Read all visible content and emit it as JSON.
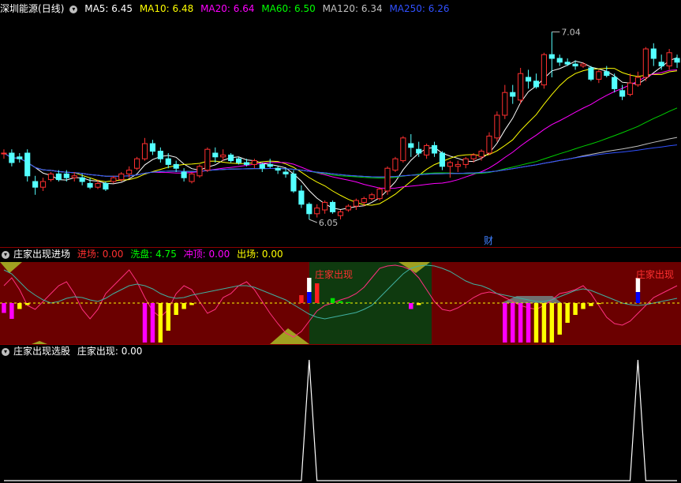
{
  "main": {
    "title": "深圳能源",
    "period": "(日线)",
    "ma": [
      {
        "label": "MA5: 6.45",
        "color": "#ffffff"
      },
      {
        "label": "MA10: 6.48",
        "color": "#ffff00"
      },
      {
        "label": "MA20: 6.64",
        "color": "#ff00ff"
      },
      {
        "label": "MA60: 6.50",
        "color": "#00ff00"
      },
      {
        "label": "MA120: 6.34",
        "color": "#c0c0c0"
      },
      {
        "label": "MA250: 6.26",
        "color": "#3050ff"
      }
    ],
    "high_label": "7.04",
    "low_label": "6.05",
    "marker": "财"
  },
  "ind1": {
    "title": "庄家出现进场",
    "fields": [
      {
        "label": "进场: 0.00",
        "color": "#ff3030"
      },
      {
        "label": "洗盘: 4.75",
        "color": "#00ff00"
      },
      {
        "label": "冲顶: 0.00",
        "color": "#ff00ff"
      },
      {
        "label": "出场: 0.00",
        "color": "#ffff00"
      }
    ],
    "annotations": [
      "庄家出现",
      "庄家出现"
    ]
  },
  "ind2": {
    "title": "庄家出现选股",
    "fields": [
      {
        "label": "庄家出现: 0.00",
        "color": "#ffffff"
      }
    ]
  },
  "chart_data": [
    {
      "type": "candlestick",
      "price_range": [
        5.95,
        7.1
      ],
      "candles": [
        [
          6.4,
          6.42,
          6.37,
          6.4
        ],
        [
          6.4,
          6.42,
          6.33,
          6.35
        ],
        [
          6.38,
          6.4,
          6.35,
          6.37
        ],
        [
          6.4,
          6.42,
          6.25,
          6.28
        ],
        [
          6.25,
          6.28,
          6.18,
          6.22
        ],
        [
          6.22,
          6.27,
          6.2,
          6.25
        ],
        [
          6.26,
          6.3,
          6.25,
          6.29
        ],
        [
          6.29,
          6.31,
          6.25,
          6.26
        ],
        [
          6.29,
          6.31,
          6.25,
          6.27
        ],
        [
          6.27,
          6.3,
          6.25,
          6.28
        ],
        [
          6.27,
          6.29,
          6.23,
          6.25
        ],
        [
          6.24,
          6.27,
          6.21,
          6.22
        ],
        [
          6.22,
          6.26,
          6.21,
          6.24
        ],
        [
          6.24,
          6.25,
          6.2,
          6.21
        ],
        [
          6.25,
          6.28,
          6.24,
          6.27
        ],
        [
          6.26,
          6.3,
          6.25,
          6.29
        ],
        [
          6.29,
          6.33,
          6.27,
          6.31
        ],
        [
          6.32,
          6.38,
          6.31,
          6.37
        ],
        [
          6.37,
          6.48,
          6.36,
          6.45
        ],
        [
          6.45,
          6.47,
          6.39,
          6.41
        ],
        [
          6.41,
          6.43,
          6.35,
          6.37
        ],
        [
          6.37,
          6.4,
          6.32,
          6.34
        ],
        [
          6.34,
          6.36,
          6.3,
          6.32
        ],
        [
          6.3,
          6.32,
          6.25,
          6.27
        ],
        [
          6.25,
          6.3,
          6.24,
          6.29
        ],
        [
          6.28,
          6.34,
          6.27,
          6.33
        ],
        [
          6.31,
          6.43,
          6.3,
          6.42
        ],
        [
          6.4,
          6.43,
          6.35,
          6.38
        ],
        [
          6.38,
          6.42,
          6.36,
          6.39
        ],
        [
          6.39,
          6.4,
          6.35,
          6.36
        ],
        [
          6.37,
          6.38,
          6.34,
          6.35
        ],
        [
          6.35,
          6.37,
          6.33,
          6.34
        ],
        [
          6.34,
          6.37,
          6.32,
          6.36
        ],
        [
          6.34,
          6.35,
          6.3,
          6.32
        ],
        [
          6.34,
          6.37,
          6.32,
          6.33
        ],
        [
          6.32,
          6.33,
          6.29,
          6.31
        ],
        [
          6.3,
          6.32,
          6.27,
          6.29
        ],
        [
          6.29,
          6.31,
          6.19,
          6.2
        ],
        [
          6.2,
          6.23,
          6.11,
          6.13
        ],
        [
          6.13,
          6.14,
          6.05,
          6.08
        ],
        [
          6.08,
          6.13,
          6.06,
          6.11
        ],
        [
          6.1,
          6.15,
          6.08,
          6.14
        ],
        [
          6.14,
          6.15,
          6.08,
          6.09
        ],
        [
          6.07,
          6.1,
          6.05,
          6.09
        ],
        [
          6.1,
          6.13,
          6.09,
          6.12
        ],
        [
          6.12,
          6.16,
          6.1,
          6.15
        ],
        [
          6.14,
          6.17,
          6.12,
          6.16
        ],
        [
          6.16,
          6.19,
          6.15,
          6.18
        ],
        [
          6.16,
          6.22,
          6.15,
          6.21
        ],
        [
          6.2,
          6.33,
          6.18,
          6.32
        ],
        [
          6.31,
          6.38,
          6.3,
          6.37
        ],
        [
          6.36,
          6.49,
          6.35,
          6.48
        ],
        [
          6.45,
          6.5,
          6.38,
          6.43
        ],
        [
          6.42,
          6.46,
          6.38,
          6.4
        ],
        [
          6.39,
          6.45,
          6.37,
          6.44
        ],
        [
          6.44,
          6.46,
          6.38,
          6.4
        ],
        [
          6.4,
          6.41,
          6.31,
          6.33
        ],
        [
          6.33,
          6.36,
          6.27,
          6.35
        ],
        [
          6.33,
          6.36,
          6.3,
          6.34
        ],
        [
          6.34,
          6.38,
          6.32,
          6.37
        ],
        [
          6.37,
          6.4,
          6.35,
          6.39
        ],
        [
          6.38,
          6.42,
          6.36,
          6.41
        ],
        [
          6.4,
          6.51,
          6.39,
          6.49
        ],
        [
          6.48,
          6.62,
          6.46,
          6.6
        ],
        [
          6.6,
          6.76,
          6.58,
          6.72
        ],
        [
          6.72,
          6.76,
          6.66,
          6.7
        ],
        [
          6.68,
          6.85,
          6.66,
          6.82
        ],
        [
          6.8,
          6.84,
          6.74,
          6.78
        ],
        [
          6.78,
          6.82,
          6.74,
          6.75
        ],
        [
          6.76,
          6.93,
          6.74,
          6.92
        ],
        [
          6.92,
          7.04,
          6.8,
          6.9
        ],
        [
          6.9,
          6.92,
          6.86,
          6.88
        ],
        [
          6.88,
          6.9,
          6.86,
          6.87
        ],
        [
          6.87,
          6.89,
          6.84,
          6.86
        ],
        [
          6.86,
          6.88,
          6.85,
          6.87
        ],
        [
          6.85,
          6.86,
          6.78,
          6.79
        ],
        [
          6.79,
          6.84,
          6.77,
          6.83
        ],
        [
          6.83,
          6.86,
          6.8,
          6.81
        ],
        [
          6.8,
          6.82,
          6.72,
          6.74
        ],
        [
          6.73,
          6.76,
          6.68,
          6.7
        ],
        [
          6.71,
          6.82,
          6.7,
          6.77
        ],
        [
          6.76,
          6.83,
          6.75,
          6.8
        ],
        [
          6.8,
          6.96,
          6.78,
          6.95
        ],
        [
          6.95,
          6.98,
          6.86,
          6.9
        ],
        [
          6.88,
          6.92,
          6.84,
          6.86
        ],
        [
          6.86,
          6.95,
          6.84,
          6.93
        ],
        [
          6.9,
          6.92,
          6.85,
          6.88
        ]
      ],
      "ma_values": {
        "MA5": 6.45,
        "MA10": 6.48,
        "MA20": 6.64,
        "MA60": 6.5,
        "MA120": 6.34,
        "MA250": 6.26
      },
      "annotations": {
        "high": 7.04,
        "low": 6.05
      }
    },
    {
      "type": "bar",
      "series": [
        {
          "name": "进场",
          "values": [
            0,
            0,
            0,
            0,
            0,
            0,
            0,
            0,
            0,
            0,
            0,
            0,
            0,
            0,
            0,
            0,
            0,
            0,
            0,
            0,
            0,
            0,
            0,
            0,
            0,
            0,
            0,
            0,
            0,
            0,
            0,
            0,
            0,
            0,
            0,
            0,
            0,
            0,
            0.4,
            0.8,
            1.0,
            0,
            0,
            0,
            0,
            0,
            0,
            0,
            0,
            0,
            0,
            0,
            0,
            0,
            0,
            0,
            0,
            0,
            0,
            0,
            0,
            0,
            0,
            0,
            0,
            0,
            0,
            0,
            0,
            0,
            0,
            0,
            0,
            0,
            0,
            0,
            0,
            0,
            0,
            0,
            0,
            0,
            0,
            0,
            0,
            0,
            0
          ]
        },
        {
          "name": "洗盘",
          "values": [
            0,
            0,
            0,
            0,
            0,
            0,
            0,
            0,
            0,
            0,
            0,
            0,
            0,
            0,
            0,
            0,
            0,
            0,
            0,
            0,
            0,
            0,
            0,
            0,
            0,
            0,
            0,
            0,
            0,
            0,
            0,
            0,
            0,
            0,
            0,
            0,
            0,
            0,
            0,
            0,
            0,
            0,
            0.25,
            0.1,
            0.05,
            0,
            0,
            0,
            0,
            0,
            0,
            0,
            0,
            0,
            0,
            0,
            0,
            0,
            0,
            0,
            0,
            0,
            0,
            0,
            0,
            0,
            0,
            0,
            0,
            0,
            0,
            0,
            0,
            0,
            0,
            0,
            0,
            0,
            0,
            0,
            0,
            0,
            0,
            0,
            0,
            0,
            0
          ]
        },
        {
          "name": "冲顶",
          "values": [
            0.5,
            0.8,
            0,
            0,
            0,
            0,
            0,
            0,
            0,
            0,
            0,
            0,
            0,
            0,
            0,
            0,
            0,
            0,
            2.0,
            2.0,
            0,
            0,
            0,
            0,
            0,
            0,
            0,
            0,
            0,
            0,
            0,
            0,
            0,
            0,
            0,
            0,
            0,
            0,
            0,
            0,
            0,
            0,
            0,
            0,
            0,
            0,
            0,
            0,
            0,
            0,
            0,
            0,
            0.3,
            0,
            0,
            0,
            0,
            0,
            0,
            0,
            0,
            0,
            0,
            0,
            2.0,
            2.0,
            2.0,
            2.0,
            0,
            0,
            0,
            0,
            0,
            0,
            0,
            0,
            0,
            0,
            0,
            0,
            0,
            0,
            0,
            0,
            0,
            0,
            0,
            0,
            0
          ]
        },
        {
          "name": "出场",
          "values": [
            0,
            0,
            0.3,
            0.1,
            0,
            0,
            0,
            0,
            0,
            0,
            0,
            0,
            0,
            0,
            0,
            0,
            0,
            0,
            0,
            0,
            2.0,
            1.4,
            0.6,
            0.3,
            0.1,
            0,
            0,
            0,
            0,
            0,
            0,
            0,
            0,
            0,
            0,
            0,
            0,
            0,
            0,
            0,
            0,
            0,
            0,
            0,
            0,
            0,
            0,
            0,
            0,
            0,
            0,
            0,
            0,
            0.1,
            0,
            0,
            0,
            0,
            0,
            0,
            0,
            0,
            0,
            0,
            0,
            0,
            0,
            0,
            2.0,
            2.0,
            2.0,
            1.6,
            1.0,
            0.6,
            0.3,
            0.15,
            0.05,
            0,
            0,
            0,
            0,
            0,
            0,
            0,
            0,
            0,
            0
          ]
        }
      ]
    },
    {
      "type": "line",
      "series": [
        {
          "name": "庄家出现",
          "values": [
            0,
            0,
            0,
            0,
            0,
            0,
            0,
            0,
            0,
            0,
            0,
            0,
            0,
            0,
            0,
            0,
            0,
            0,
            0,
            0,
            0,
            0,
            0,
            0,
            0,
            0,
            0,
            0,
            0,
            0,
            0,
            0,
            0,
            0,
            0,
            0,
            0,
            0,
            0,
            1,
            0,
            0,
            0,
            0,
            0,
            0,
            0,
            0,
            0,
            0,
            0,
            0,
            0,
            0,
            0,
            0,
            0,
            0,
            0,
            0,
            0,
            0,
            0,
            0,
            0,
            0,
            0,
            0,
            0,
            0,
            0,
            0,
            0,
            0,
            0,
            0,
            0,
            0,
            0,
            0,
            0,
            1,
            0,
            0,
            0,
            0,
            0
          ]
        }
      ]
    }
  ]
}
